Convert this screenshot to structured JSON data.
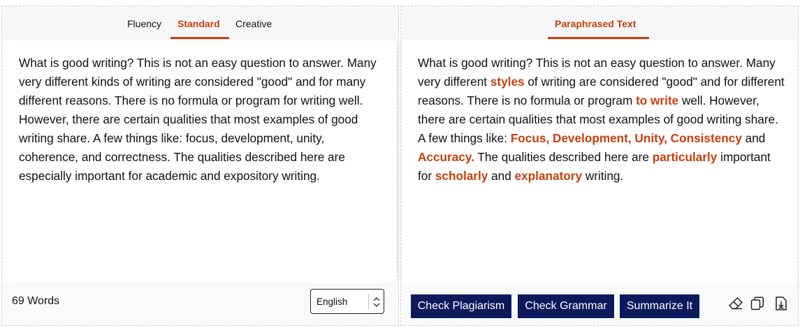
{
  "left_panel": {
    "tabs": [
      {
        "label": "Fluency",
        "active": false
      },
      {
        "label": "Standard",
        "active": true
      },
      {
        "label": "Creative",
        "active": false
      }
    ],
    "input_text": "What is good writing? This is not an easy question to answer. Many very different kinds of writing are considered \"good\" and for many different reasons. There is no formula or program for writing well. However, there are certain qualities that most examples of good writing share. A few things like: focus, development, unity, coherence, and correctness. The qualities described here are especially important for academic and expository writing.",
    "word_count": "69 Words",
    "language_select": {
      "selected": "English"
    }
  },
  "right_panel": {
    "tab_label": "Paraphrased Text",
    "output_segments": [
      {
        "text": "What is good writing? This is not an easy question to answer. Many very different ",
        "changed": false
      },
      {
        "text": "styles",
        "changed": true
      },
      {
        "text": " of writing are considered \"good\" and for  different reasons. There is no formula or program ",
        "changed": false
      },
      {
        "text": "to write",
        "changed": true
      },
      {
        "text": " well. However, there are certain qualities that most examples of good writing share. A few things like: ",
        "changed": false
      },
      {
        "text": "Focus, Development, Unity, Consistency",
        "changed": true
      },
      {
        "text": " and ",
        "changed": false
      },
      {
        "text": "Accuracy.",
        "changed": true
      },
      {
        "text": " The qualities described here are ",
        "changed": false
      },
      {
        "text": "particularly",
        "changed": true
      },
      {
        "text": " important for ",
        "changed": false
      },
      {
        "text": "scholarly",
        "changed": true
      },
      {
        "text": " and ",
        "changed": false
      },
      {
        "text": "explanatory",
        "changed": true
      },
      {
        "text": " writing.",
        "changed": false
      }
    ],
    "buttons": {
      "check_plagiarism": "Check Plagiarism",
      "check_grammar": "Check Grammar",
      "summarize": "Summarize It"
    },
    "icons": [
      "eraser-icon",
      "copy-icon",
      "download-icon"
    ]
  },
  "colors": {
    "accent": "#c83f0d",
    "button_bg": "#0c1a5b"
  }
}
